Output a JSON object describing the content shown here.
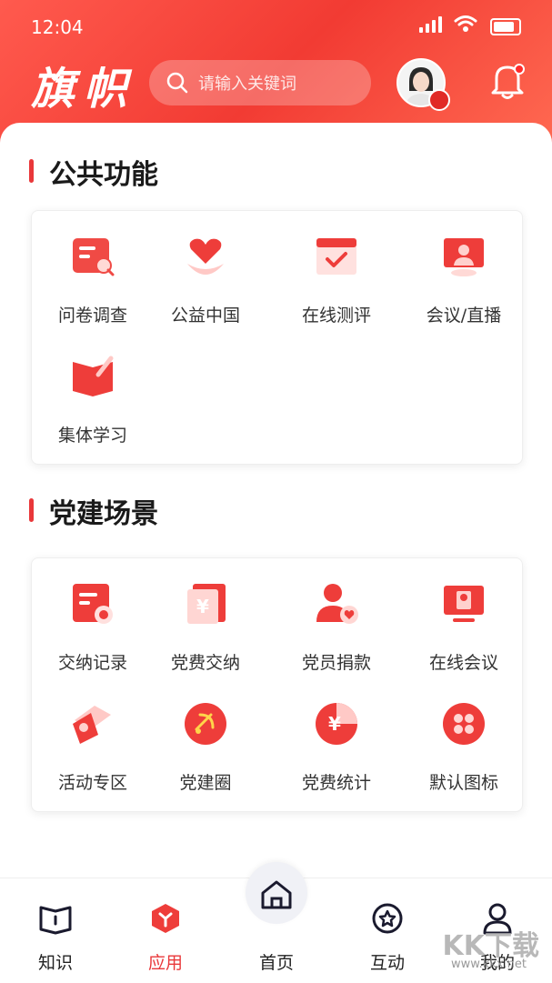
{
  "status": {
    "time": "12:04"
  },
  "header": {
    "logo": "旗帜",
    "search_placeholder": "请输入关键词"
  },
  "sections": [
    {
      "title": "公共功能",
      "items": [
        {
          "label": "问卷调查",
          "icon": "survey-icon"
        },
        {
          "label": "公益中国",
          "icon": "heart-hand-icon"
        },
        {
          "label": "在线测评",
          "icon": "check-calendar-icon"
        },
        {
          "label": "会议/直播",
          "icon": "meeting-screen-icon"
        },
        {
          "label": "集体学习",
          "icon": "book-pen-icon"
        }
      ]
    },
    {
      "title": "党建场景",
      "items": [
        {
          "label": "交纳记录",
          "icon": "payment-record-icon"
        },
        {
          "label": "党费交纳",
          "icon": "yuan-receipt-icon"
        },
        {
          "label": "党员捐款",
          "icon": "member-donate-icon"
        },
        {
          "label": "在线会议",
          "icon": "online-meeting-icon"
        },
        {
          "label": "活动专区",
          "icon": "flag-activity-icon"
        },
        {
          "label": "党建圈",
          "icon": "party-emblem-icon"
        },
        {
          "label": "党费统计",
          "icon": "yuan-pie-icon"
        },
        {
          "label": "默认图标",
          "icon": "grid-clover-icon"
        }
      ]
    }
  ],
  "tabbar": [
    {
      "label": "知识",
      "icon": "book-icon"
    },
    {
      "label": "应用",
      "icon": "cube-icon",
      "active": true
    },
    {
      "label": "首页",
      "icon": "home-icon"
    },
    {
      "label": "互动",
      "icon": "star-circle-icon"
    },
    {
      "label": "我的",
      "icon": "user-icon"
    }
  ],
  "watermark": {
    "main": "KK下载",
    "sub": "www.kkx.net"
  },
  "colors": {
    "primary": "#e9383a",
    "header_gradient_start": "#ff5a4e",
    "header_gradient_end": "#f23b33"
  }
}
